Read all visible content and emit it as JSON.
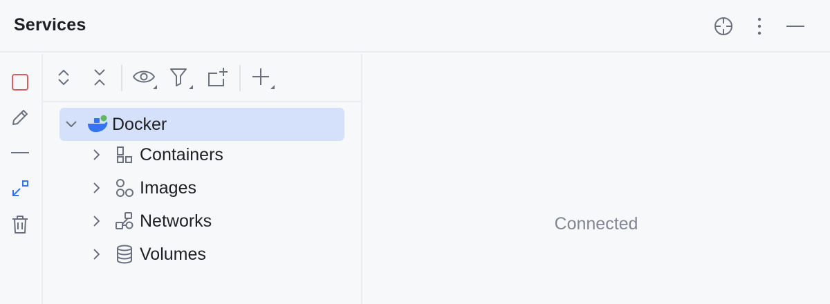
{
  "header": {
    "title": "Services",
    "actions": [
      {
        "icon": "locate-icon"
      },
      {
        "icon": "more-vertical-icon"
      },
      {
        "icon": "minimize-icon"
      }
    ]
  },
  "left_bar": {
    "actions": [
      {
        "icon": "stop-icon"
      },
      {
        "icon": "edit-icon"
      },
      {
        "icon": "minus-icon"
      },
      {
        "icon": "restore-icon"
      },
      {
        "icon": "delete-icon"
      }
    ]
  },
  "toolbar": {
    "actions": [
      {
        "icon": "expand-all-icon"
      },
      {
        "icon": "collapse-all-icon"
      },
      {
        "icon": "show-icon"
      },
      {
        "icon": "filter-icon"
      },
      {
        "icon": "new-group-icon"
      },
      {
        "icon": "add-icon"
      }
    ]
  },
  "tree": {
    "root": {
      "label": "Docker",
      "expanded": true,
      "selected": true,
      "status_color": "#5fb865"
    },
    "children": [
      {
        "label": "Containers",
        "icon": "containers-icon"
      },
      {
        "label": "Images",
        "icon": "images-icon"
      },
      {
        "label": "Networks",
        "icon": "networks-icon"
      },
      {
        "label": "Volumes",
        "icon": "volumes-icon"
      }
    ]
  },
  "detail": {
    "status_text": "Connected"
  },
  "colors": {
    "accent": "#3574f0",
    "stop_red": "#db5c5c",
    "selection": "#d5e1fa",
    "icon_gray": "#6c707e"
  }
}
